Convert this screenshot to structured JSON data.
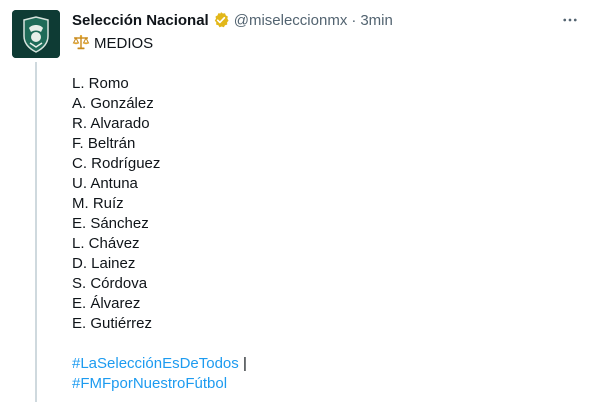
{
  "tweet": {
    "display_name": "Selección Nacional",
    "handle": "@miseleccionmx",
    "separator": "·",
    "time": "3min",
    "heading_emoji": "balance-scale-icon",
    "heading": "MEDIOS",
    "players": [
      "L. Romo",
      "A. González",
      "R. Alvarado",
      "F. Beltrán",
      "C. Rodríguez",
      "U. Antuna",
      "M. Ruíz",
      "E. Sánchez",
      "L. Chávez",
      "D. Lainez",
      "S. Córdova",
      "E. Álvarez",
      "E. Gutiérrez"
    ],
    "hashtag_1": "#LaSelecciónEsDeTodos",
    "pipe": "|",
    "hashtag_2": "#FMFporNuestroFútbol"
  },
  "colors": {
    "text": "#0f1419",
    "secondary": "#536471",
    "link": "#1d9bf0",
    "verified_badge": "#e2b719",
    "avatar_bg": "#0e3b34",
    "thread_line": "#cfd9de"
  },
  "icons": {
    "avatar": "fmf-crest-icon",
    "verified": "verified-badge-icon",
    "more": "more-horizontal-icon"
  }
}
